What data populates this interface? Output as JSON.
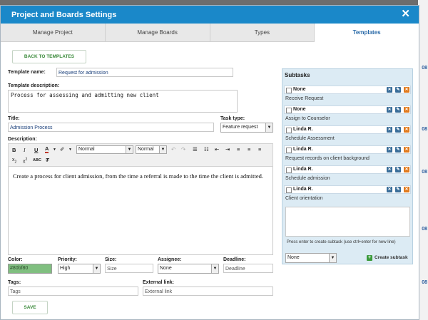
{
  "dialog": {
    "title": "Project and Boards Settings",
    "close_glyph": "✕"
  },
  "tabs": [
    {
      "label": "Manage Project",
      "active": false
    },
    {
      "label": "Manage Boards",
      "active": false
    },
    {
      "label": "Types",
      "active": false
    },
    {
      "label": "Templates",
      "active": true
    }
  ],
  "back_button": "BACK TO TEMPLATES",
  "template_name": {
    "label": "Template name:",
    "value": "Request for admission"
  },
  "template_description": {
    "label": "Template description:",
    "value": "Process for assessing and admitting new client"
  },
  "title_field": {
    "label": "Title:",
    "value": "Admission Process"
  },
  "task_type": {
    "label": "Task type:",
    "value": "Feature request"
  },
  "description": {
    "label": "Description:",
    "font_family_select": "Normal",
    "font_size_select": "Normal",
    "text": "Create a process for client admission, from the time a referral is made to the time the client is admitted."
  },
  "color": {
    "label": "Color:",
    "value": "#80bf80",
    "display": "#80bf80"
  },
  "priority": {
    "label": "Priority:",
    "value": "High"
  },
  "size": {
    "label": "Size:",
    "placeholder": "Size"
  },
  "assignee": {
    "label": "Assignee:",
    "value": "None"
  },
  "deadline": {
    "label": "Deadline:",
    "placeholder": "Deadline"
  },
  "tags": {
    "label": "Tags:",
    "placeholder": "Tags"
  },
  "external_link": {
    "label": "External link:",
    "placeholder": "External link"
  },
  "save_button": "SAVE",
  "subtasks": {
    "heading": "Subtasks",
    "items": [
      {
        "assignee": "None",
        "name": "Receive Request"
      },
      {
        "assignee": "None",
        "name": "Assign to Counselor"
      },
      {
        "assignee": "Linda R.",
        "name": "Schedule Assessment"
      },
      {
        "assignee": "Linda R.",
        "name": "Request records on client background"
      },
      {
        "assignee": "Linda R.",
        "name": "Schedule admission"
      },
      {
        "assignee": "Linda R.",
        "name": "Client orientation"
      }
    ],
    "hint": "Press enter to create subtask (use ctrl+enter for new line)",
    "assignee_select": "None",
    "create_label": "Create subtask"
  },
  "colors": {
    "titlebar": "#1a88c9",
    "subtask_panel": "#dcebf4",
    "accent_green": "#3b9a3b"
  }
}
